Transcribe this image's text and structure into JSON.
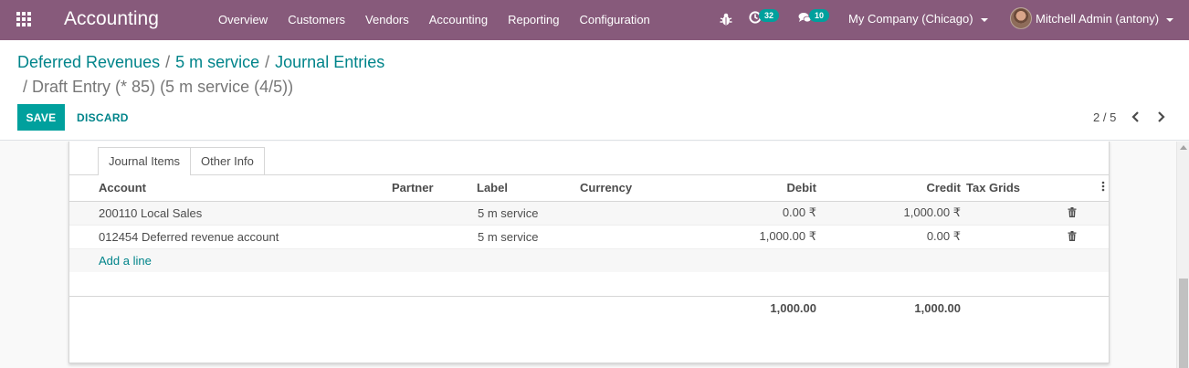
{
  "navbar": {
    "brand": "Accounting",
    "menu": [
      "Overview",
      "Customers",
      "Vendors",
      "Accounting",
      "Reporting",
      "Configuration"
    ],
    "activity_count": "32",
    "message_count": "10",
    "company": "My Company (Chicago)",
    "user": "Mitchell Admin (antony)"
  },
  "breadcrumb": {
    "items": [
      "Deferred Revenues",
      "5 m service",
      "Journal Entries"
    ],
    "current": "Draft Entry (* 85) (5 m service (4/5))"
  },
  "actions": {
    "save": "SAVE",
    "discard": "DISCARD"
  },
  "pager": {
    "value": "2 / 5"
  },
  "tabs": [
    {
      "label": "Journal Items",
      "active": true
    },
    {
      "label": "Other Info",
      "active": false
    }
  ],
  "table": {
    "columns": {
      "account": "Account",
      "partner": "Partner",
      "label": "Label",
      "currency": "Currency",
      "debit": "Debit",
      "credit": "Credit",
      "tax_grids": "Tax Grids"
    },
    "rows": [
      {
        "account": "200110 Local Sales",
        "partner": "",
        "label": "5 m service",
        "currency": "",
        "debit": "0.00 ₹",
        "credit": "1,000.00 ₹",
        "tax_grids": ""
      },
      {
        "account": "012454 Deferred revenue account",
        "partner": "",
        "label": "5 m service",
        "currency": "",
        "debit": "1,000.00 ₹",
        "credit": "0.00 ₹",
        "tax_grids": ""
      }
    ],
    "add_line": "Add a line",
    "totals": {
      "debit": "1,000.00",
      "credit": "1,000.00"
    }
  },
  "colors": {
    "navbar": "#875a7b",
    "primary": "#00a09d",
    "link": "#00848a"
  }
}
